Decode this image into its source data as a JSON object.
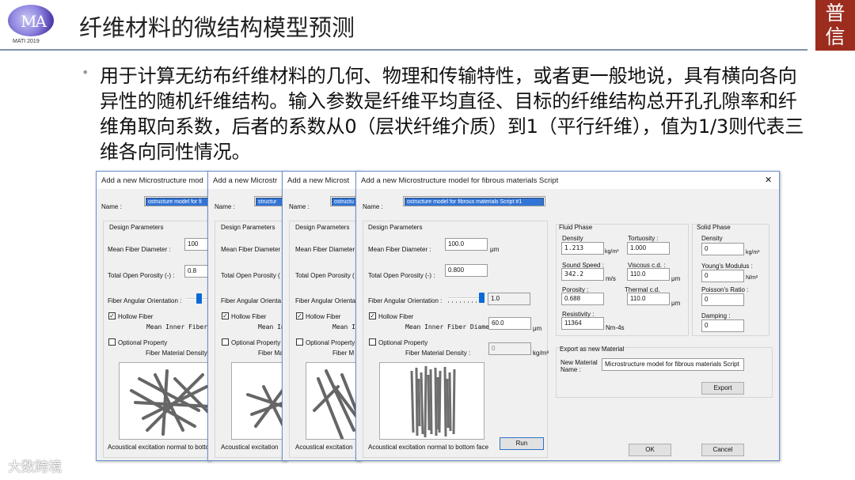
{
  "slide": {
    "logo_text": "MA",
    "logo_sub": "MATI 2019",
    "title": "纤维材料的微结构模型预测",
    "seal_text_1": "普",
    "seal_text_2": "信",
    "bullet": "•",
    "paragraph": "用于计算无纺布纤维材料的几何、物理和传输特性，或者更一般地说，具有横向各向异性的随机纤维结构。输入参数是纤维平均直径、目标的纤维结构总开孔孔隙率和纤维角取向系数，后者的系数从0（层状纤维介质）到1（平行纤维），值为1/3则代表三维各向同性情况。",
    "watermark": "大数跨境"
  },
  "dlg1": {
    "title": "Add a new Microstructure mod",
    "name_label": "Name :",
    "name_value": "ostructure model for fi",
    "design": "Design Parameters",
    "mfd_label": "Mean Fiber Diameter :",
    "mfd_value": "100",
    "top_label": "Total Open Porosity (-) :",
    "top_value": "0.8",
    "fao_label": "Fiber Angular Orientation :",
    "hollow": "Hollow Fiber",
    "mif": "Mean Inner Fiber",
    "opt": "Optional Property",
    "fmd": "Fiber Material Density",
    "acoustic": "Acoustical excitation normal to botto"
  },
  "dlg2": {
    "title": "Add a new Microstr",
    "name_label": "Name :",
    "name_value": "structur",
    "design": "Design Parameters",
    "mfd_label": "Mean Fiber Diameter",
    "top_label": "Total Open Porosity (",
    "fao_label": "Fiber Angular Orienta",
    "hollow": "Hollow Fiber",
    "mif": "Mean In",
    "opt": "Optional Property",
    "fmd": "Fiber Ma",
    "acoustic": "Acoustical excitation"
  },
  "dlg3": {
    "title": "Add a new Microst",
    "name_label": "Name :",
    "name_value": "ostructu",
    "design": "Design Parameters",
    "mfd_label": "Mean Fiber Diameter",
    "top_label": "Total Open Porosity (",
    "fao_label": "Fiber Angular Orienta",
    "hollow": "Hollow Fiber",
    "mif": "Mean I",
    "opt": "Optional Property",
    "fmd": "Fiber M",
    "acoustic": "Acoustical excitation"
  },
  "dlg4": {
    "title": "Add a new Microstructure model for fibrous materials Script",
    "close": "✕",
    "name_label": "Name :",
    "name_value": "ostructure model for fibrous materials Script #1",
    "design": "Design Parameters",
    "mfd_label": "Mean Fiber Diameter :",
    "mfd_value": "100.0",
    "mfd_unit": "μm",
    "top_label": "Total Open Porosity (-) :",
    "top_value": "0.800",
    "fao_label": "Fiber Angular Orientation :",
    "fao_value": "1.0",
    "fao_level": 1.0,
    "hollow": "Hollow Fiber",
    "mif_label": "Mean Inner Fiber Diamet",
    "mif_value": "60.0",
    "mif_unit": "μm",
    "opt": "Optional Property",
    "fmd_label": "Fiber Material Density :",
    "fmd_value": "0",
    "fmd_unit": "kg/m³",
    "run": "Run",
    "acoustic": "Acoustical excitation normal to bottom face",
    "fluid": {
      "title": "Fluid Phase",
      "density_label": "Density",
      "density_value": "1.213",
      "density_unit": "kg/m³",
      "tort_label": "Tortuosity :",
      "tort_value": "1.000",
      "sound_label": "Sound Speed :",
      "sound_value": "342.2",
      "sound_unit": "m/s",
      "visc_label": "Viscous c.d. :",
      "visc_value": "110.0",
      "visc_unit": "μm",
      "poro_label": "Porosity :",
      "poro_value": "0.688",
      "therm_label": "Thermal c.d.",
      "therm_value": "110.0",
      "therm_unit": "μm",
      "resist_label": "Resistivity :",
      "resist_value": "11364",
      "resist_unit": "Nm-4s"
    },
    "solid": {
      "title": "Solid Phase",
      "density_label": "Density",
      "density_value": "0",
      "density_unit": "kg/m³",
      "young_label": "Young's Modulus :",
      "young_value": "0",
      "young_unit": "N/m²",
      "poisson_label": "Poisson's Ratio :",
      "poisson_value": "0",
      "damping_label": "Damping :",
      "damping_value": "0"
    },
    "export": {
      "title": "Export as new Material",
      "name_label": "New Material Name :",
      "name_value": "Microstructure model for fibrous materials Script",
      "button": "Export"
    },
    "ok": "OK",
    "cancel": "Cancel"
  }
}
